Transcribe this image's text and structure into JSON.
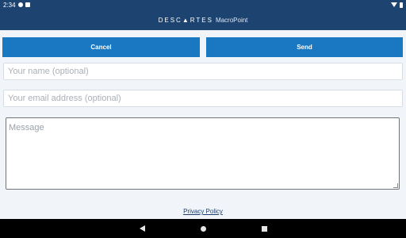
{
  "status_bar": {
    "time": "2:34",
    "icons": [
      "notification-icon",
      "sim-icon",
      "wifi-icon",
      "battery-icon"
    ]
  },
  "header": {
    "brand": "DESC▲RTES",
    "product": "MacroPoint"
  },
  "buttons": {
    "cancel": "Cancel",
    "send": "Send"
  },
  "form": {
    "name_placeholder": "Your name (optional)",
    "email_placeholder": "Your email address (optional)",
    "message_placeholder": "Message"
  },
  "footer": {
    "privacy_link": "Privacy Policy"
  },
  "nav": {
    "icons": [
      "back-icon",
      "home-icon",
      "recent-apps-icon"
    ]
  },
  "colors": {
    "header_bg": "#1d4370",
    "button_bg": "#1a78c2",
    "page_bg": "#f1f5f9"
  }
}
